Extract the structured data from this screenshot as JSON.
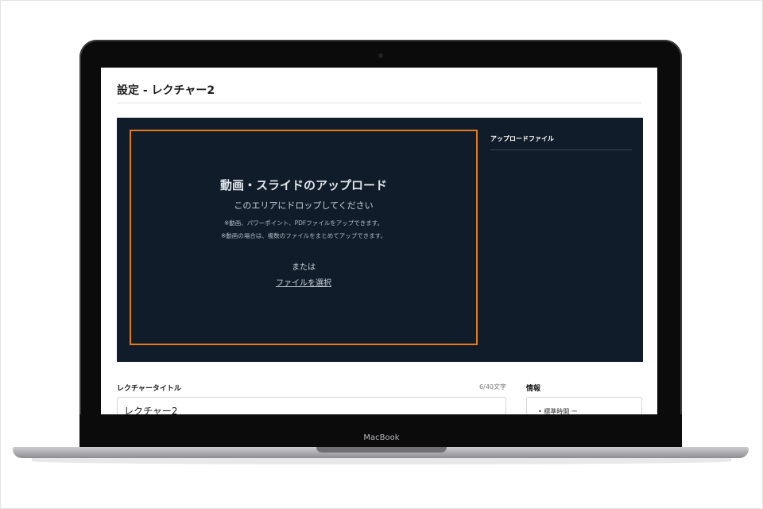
{
  "device": {
    "brand": "MacBook"
  },
  "page": {
    "title": "設定 - レクチャー2"
  },
  "upload": {
    "heading": "動画・スライドのアップロード",
    "subheading": "このエリアにドロップしてください",
    "note1": "※動画、パワーポイント、PDFファイルをアップできます。",
    "note2": "※動画の場合は、複数のファイルをまとめてアップできます。",
    "or_text": "または",
    "select_link": "ファイルを選択"
  },
  "uploaded_files": {
    "title": "アップロードファイル"
  },
  "lecture_title": {
    "label": "レクチャータイトル",
    "char_count": "6/40文字",
    "value": "レクチャー2"
  },
  "info": {
    "label": "情報",
    "item": "• 標準時間 ー"
  },
  "colors": {
    "panel_bg": "#111c2a",
    "dropzone_border": "#e57b17"
  }
}
